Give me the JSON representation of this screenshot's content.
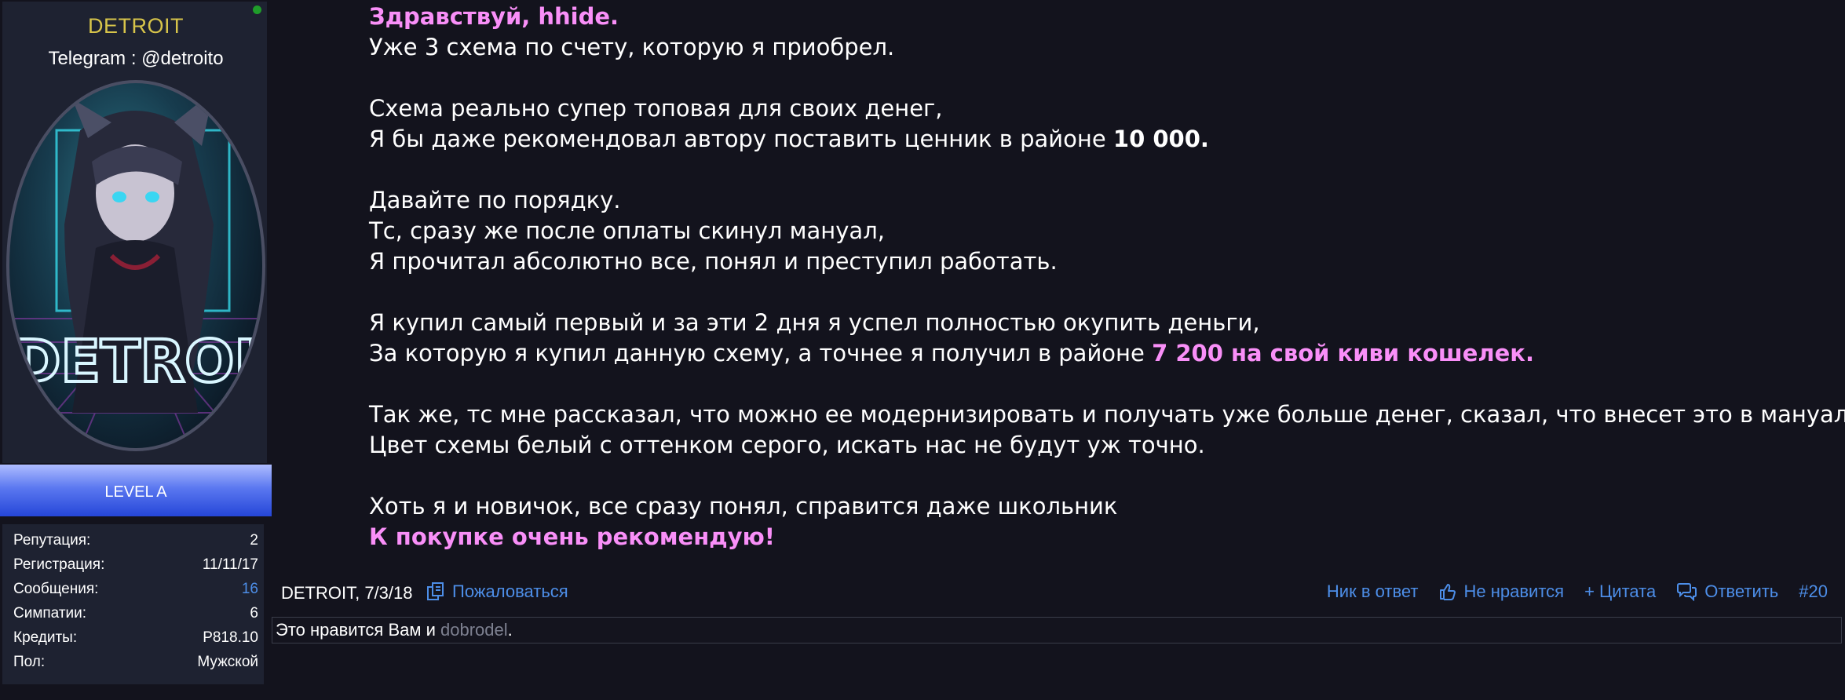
{
  "user": {
    "name": "DETROIT",
    "title": "Telegram : @detroito",
    "avatar_text": "DETROIT",
    "level": "LEVEL A",
    "stats": [
      {
        "label": "Репутация:",
        "value": "2"
      },
      {
        "label": "Регистрация:",
        "value": "11/11/17"
      },
      {
        "label": "Сообщения:",
        "value": "16"
      },
      {
        "label": "Симпатии:",
        "value": "6"
      },
      {
        "label": "Кредиты:",
        "value": "P818.10"
      },
      {
        "label": "Пол:",
        "value": "Мужской"
      }
    ]
  },
  "message": {
    "greeting": "Здравствуй, hhide.",
    "l1": "Уже 3 схема по счету, которую я приобрел.",
    "l2": "Схема реально супер топовая для своих денег,",
    "l3a": "Я бы даже рекомендовал автору поставить ценник в районе ",
    "l3b": "10 000.",
    "l4": "Давайте по порядку.",
    "l5": "Тс, сразу же после оплаты скинул мануал,",
    "l6": "Я прочитал абсолютно все, понял и преступил работать.",
    "l7": "Я купил самый первый и за эти 2 дня я успел полностью окупить деньги,",
    "l8a": "За которую я купил данную схему, а точнее я получил в районе ",
    "l8b": "7 200 на свой киви кошелек.",
    "l9": "Так же, тс мне рассказал, что можно ее модернизировать и получать уже больше денег, сказал, что внесет это в мануал.",
    "l10": "Цвет схемы белый с оттенком серого, искать нас не будут уж точно.",
    "l11": "Хоть я и новичок, все сразу понял, справится даже школьник",
    "l12": "К покупке очень рекомендую!"
  },
  "footer": {
    "author_date": "DETROIT, 7/3/18",
    "report": "Пожаловаться",
    "nick_reply": "Ник в ответ",
    "dislike": "Не нравится",
    "quote": "+ Цитата",
    "reply": "Ответить",
    "post_number": "#20"
  },
  "likes": {
    "prefix": "Это нравится Вам и ",
    "liker": "dobrodel",
    "suffix": "."
  },
  "colors": {
    "background": "#13131d",
    "panel": "#1e2231",
    "username": "#d7c44a",
    "link": "#4d8ee8",
    "highlight": "#f98ff8"
  }
}
